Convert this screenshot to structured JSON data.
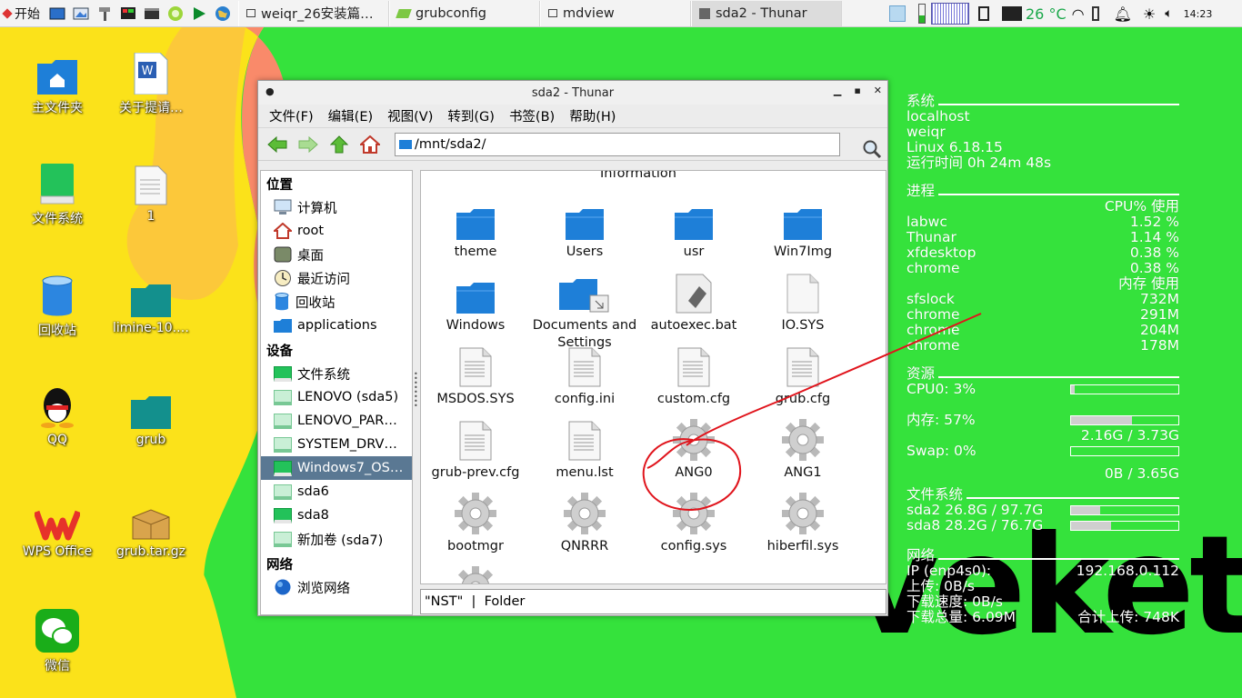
{
  "taskbar": {
    "start_label": "开始",
    "tasks": [
      {
        "label": "weiqr_26安装篇…",
        "active": false
      },
      {
        "label": "grubconfig",
        "active": false
      },
      {
        "label": "mdview",
        "active": false
      },
      {
        "label": "sda2 - Thunar",
        "active": true
      }
    ],
    "temperature": "26 °C",
    "clock": "14:23"
  },
  "desktop": {
    "icons": [
      {
        "label": "主文件夹"
      },
      {
        "label": "关于提请…"
      },
      {
        "label": "文件系统"
      },
      {
        "label": "1"
      },
      {
        "label": "回收站"
      },
      {
        "label": "limine-10.…"
      },
      {
        "label": "QQ"
      },
      {
        "label": "grub"
      },
      {
        "label": "WPS Office"
      },
      {
        "label": "grub.tar.gz"
      },
      {
        "label": "微信"
      }
    ],
    "watermark": "veket"
  },
  "window": {
    "title": "sda2 - Thunar",
    "menu": [
      "文件(F)",
      "编辑(E)",
      "视图(V)",
      "转到(G)",
      "书签(B)",
      "帮助(H)"
    ],
    "path": "/mnt/sda2/",
    "sidebar": {
      "places_header": "位置",
      "places": [
        "计算机",
        "root",
        "桌面",
        "最近访问",
        "回收站",
        "applications"
      ],
      "devices_header": "设备",
      "devices": [
        "文件系统",
        "LENOVO (sda5)",
        "LENOVO_PAR…",
        "SYSTEM_DRV…",
        "Windows7_OS…",
        "sda6",
        "sda8",
        "新加卷 (sda7)"
      ],
      "network_header": "网络",
      "network": [
        "浏览网络"
      ]
    },
    "partial_label": "Information",
    "files": [
      {
        "name": "theme"
      },
      {
        "name": "Users"
      },
      {
        "name": "usr"
      },
      {
        "name": "Win7Img"
      },
      {
        "name": "Windows"
      },
      {
        "name": "Documents and Settings"
      },
      {
        "name": "autoexec.bat"
      },
      {
        "name": "IO.SYS"
      },
      {
        "name": "MSDOS.SYS"
      },
      {
        "name": "config.ini"
      },
      {
        "name": "custom.cfg"
      },
      {
        "name": "grub.cfg"
      },
      {
        "name": "grub-prev.cfg"
      },
      {
        "name": "menu.lst"
      },
      {
        "name": "ANG0"
      },
      {
        "name": "ANG1"
      },
      {
        "name": "bootmgr"
      },
      {
        "name": "QNRRR"
      },
      {
        "name": "config.sys"
      },
      {
        "name": "hiberfil.sys"
      }
    ],
    "status": "\"NST\"  |  Folder"
  },
  "conky": {
    "system": {
      "header": "系统",
      "lines": [
        "localhost",
        "weiqr",
        "Linux 6.18.15",
        "运行时间 0h 24m 48s"
      ]
    },
    "process": {
      "header": "进程",
      "cpu_col": "CPU% 使用",
      "cpu_rows": [
        {
          "name": "labwc",
          "val": "1.52 %"
        },
        {
          "name": "Thunar",
          "val": "1.14 %"
        },
        {
          "name": "xfdesktop",
          "val": "0.38 %"
        },
        {
          "name": "chrome",
          "val": "0.38 %"
        }
      ],
      "mem_col": "内存  使用",
      "mem_rows": [
        {
          "name": "sfslock",
          "val": "732M"
        },
        {
          "name": "chrome",
          "val": "291M"
        },
        {
          "name": "chrome",
          "val": "204M"
        },
        {
          "name": "chrome",
          "val": "178M"
        }
      ]
    },
    "resources": {
      "header": "资源",
      "cpu": {
        "label": "CPU0: 3%",
        "fraction": 0.03
      },
      "mem": {
        "label": "内存: 57%",
        "fraction": 0.57,
        "detail": "2.16G / 3.73G"
      },
      "swap": {
        "label": "Swap: 0%",
        "fraction": 0.0,
        "detail": "0B / 3.65G"
      }
    },
    "filesystem": {
      "header": "文件系统",
      "rows": [
        {
          "label": "sda2 26.8G / 97.7G",
          "fraction": 0.27
        },
        {
          "label": "sda8 28.2G / 76.7G",
          "fraction": 0.37
        }
      ]
    },
    "network": {
      "header": "网络",
      "ip": "IP (enp4s0):",
      "ip_val": "192.168.0.112",
      "up": "上传: 0B/s",
      "down": "下载速度: 0B/s",
      "total_down": "下载总量: 6.09M",
      "total_up": "合计上传: 748K"
    }
  },
  "colors": {
    "desktop_green": "#35e23c",
    "desktop_yellow": "#fbe21a",
    "folder_blue": "#1e7fd8",
    "selection": "#5a7893",
    "annotation_red": "#e0141c"
  }
}
